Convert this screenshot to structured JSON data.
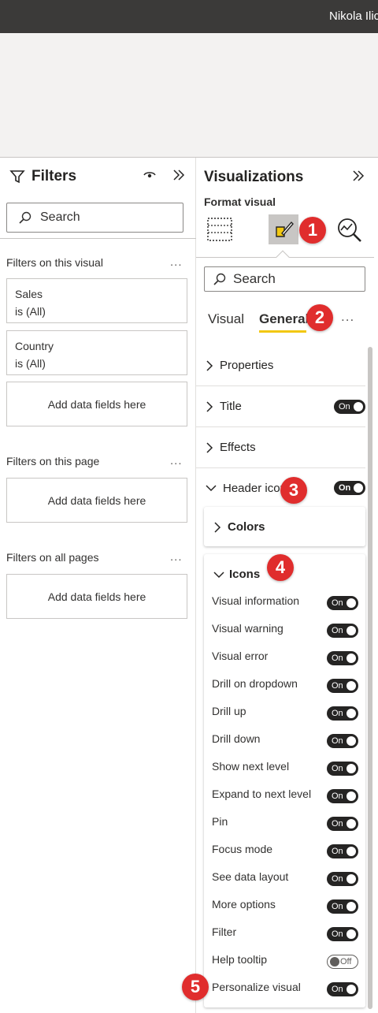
{
  "topbar": {
    "user_name": "Nikola Ilic"
  },
  "filters": {
    "title": "Filters",
    "search_placeholder": "Search",
    "this_visual": {
      "label": "Filters on this visual",
      "more": "...",
      "cards": [
        {
          "field": "Sales",
          "value": "is (All)"
        },
        {
          "field": "Country",
          "value": "is (All)"
        }
      ],
      "add": "Add data fields here"
    },
    "this_page": {
      "label": "Filters on this page",
      "more": "...",
      "add": "Add data fields here"
    },
    "all_pages": {
      "label": "Filters on all pages",
      "more": "...",
      "add": "Add data fields here"
    }
  },
  "viz": {
    "title": "Visualizations",
    "subtitle": "Format visual",
    "search_placeholder": "Search",
    "tabs": {
      "visual": "Visual",
      "general": "General"
    },
    "more": "...",
    "sections": {
      "properties": "Properties",
      "title": {
        "label": "Title",
        "toggle": "On"
      },
      "effects": "Effects",
      "header_icons": {
        "label": "Header icons",
        "toggle": "On"
      }
    },
    "colors_card": {
      "label": "Colors"
    },
    "icons_card": {
      "label": "Icons",
      "options": [
        {
          "label": "Visual information",
          "toggle": "On"
        },
        {
          "label": "Visual warning",
          "toggle": "On"
        },
        {
          "label": "Visual error",
          "toggle": "On"
        },
        {
          "label": "Drill on dropdown",
          "toggle": "On"
        },
        {
          "label": "Drill up",
          "toggle": "On"
        },
        {
          "label": "Drill down",
          "toggle": "On"
        },
        {
          "label": "Show next level",
          "toggle": "On"
        },
        {
          "label": "Expand to next level",
          "toggle": "On"
        },
        {
          "label": "Pin",
          "toggle": "On"
        },
        {
          "label": "Focus mode",
          "toggle": "On"
        },
        {
          "label": "See data layout",
          "toggle": "On"
        },
        {
          "label": "More options",
          "toggle": "On"
        },
        {
          "label": "Filter",
          "toggle": "On"
        },
        {
          "label": "Help tooltip",
          "toggle": "Off"
        },
        {
          "label": "Personalize visual",
          "toggle": "On"
        }
      ]
    }
  },
  "markers": [
    "1",
    "2",
    "3",
    "4",
    "5"
  ],
  "colors": {
    "accent": "#f2c811",
    "marker": "#e02d2d",
    "topbar": "#3b3a39"
  }
}
